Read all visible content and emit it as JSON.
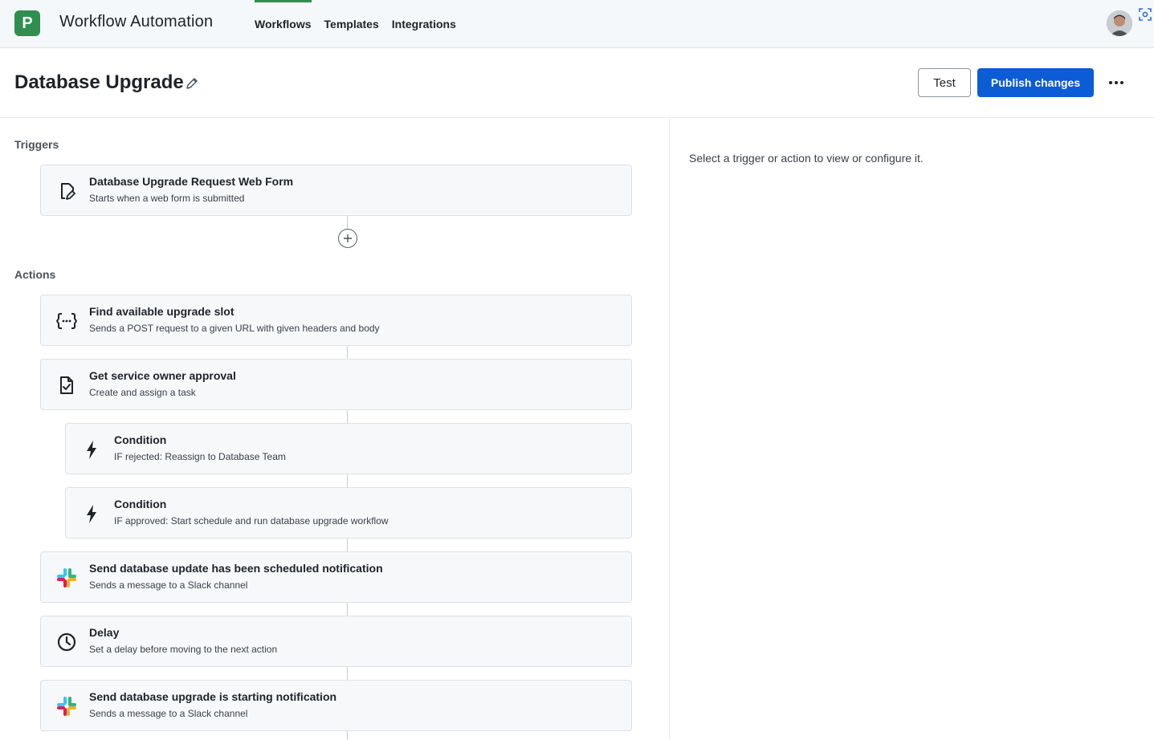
{
  "app": {
    "logo_letter": "P",
    "title": "Workflow Automation"
  },
  "nav": {
    "tabs": [
      {
        "label": "Workflows",
        "active": true
      },
      {
        "label": "Templates"
      },
      {
        "label": "Integrations"
      }
    ]
  },
  "header": {
    "title": "Database Upgrade",
    "test_label": "Test",
    "publish_label": "Publish changes"
  },
  "triggers": {
    "label": "Triggers",
    "items": [
      {
        "title": "Database Upgrade Request Web Form",
        "subtitle": "Starts when a web form is submitted",
        "icon": "web-form-icon"
      }
    ]
  },
  "actions": {
    "label": "Actions",
    "items": [
      {
        "title": "Find available upgrade slot",
        "subtitle": "Sends a POST request to a given URL with given headers and body",
        "icon": "http-request-icon"
      },
      {
        "title": "Get service owner approval",
        "subtitle": "Create and assign a task",
        "icon": "task-approval-icon"
      },
      {
        "title": "Condition",
        "subtitle": "IF rejected: Reassign to Database Team",
        "icon": "lightning-icon"
      },
      {
        "title": "Condition",
        "subtitle": "IF approved: Start schedule and run database upgrade workflow",
        "icon": "lightning-icon"
      },
      {
        "title": "Send database update has been scheduled notification",
        "subtitle": "Sends a message to a Slack channel",
        "icon": "slack-icon"
      },
      {
        "title": "Delay",
        "subtitle": "Set a delay before moving to the next action",
        "icon": "clock-icon"
      },
      {
        "title": "Send database upgrade is starting notification",
        "subtitle": "Sends a message to a Slack channel",
        "icon": "slack-icon"
      }
    ]
  },
  "details_panel": {
    "hint": "Select a trigger or action to view or configure it."
  },
  "colors": {
    "brand_green": "#2f8f4e",
    "primary_blue": "#0b5cd5",
    "card_bg": "#f6f8fa"
  }
}
